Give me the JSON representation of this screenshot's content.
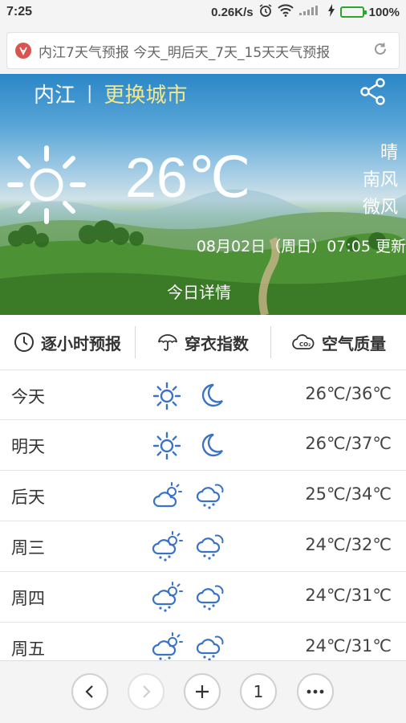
{
  "status_bar": {
    "time": "7:25",
    "network_speed": "0.26K/s",
    "battery": "100%",
    "icons": [
      "alarm-icon",
      "wifi-icon",
      "signal-icon",
      "charging-icon",
      "battery-icon"
    ]
  },
  "address_bar": {
    "text": "内江7天气预报 今天_明后天_7天_15天天气预报",
    "site_icon": "site-logo-icon",
    "reload_icon": "reload-icon"
  },
  "hero": {
    "city": "内江",
    "separator": "|",
    "change_city": "更换城市",
    "temperature": "26℃",
    "condition": "晴",
    "wind_direction": "南风",
    "wind_level": "微风",
    "update_time": "08月02日（周日）07:05 更新",
    "detail_link": "今日详情",
    "colors": {
      "change_city": "#f4e78a",
      "text": "#ffffff"
    }
  },
  "tabs": [
    {
      "label": "逐小时预报",
      "icon": "clock-icon"
    },
    {
      "label": "穿衣指数",
      "icon": "umbrella-icon"
    },
    {
      "label": "空气质量",
      "icon": "cloud-co2-icon"
    }
  ],
  "forecast": [
    {
      "day": "今天",
      "day_icon": "sun",
      "night_icon": "moon",
      "temp": "26℃/36℃"
    },
    {
      "day": "明天",
      "day_icon": "sun",
      "night_icon": "moon",
      "temp": "26℃/37℃"
    },
    {
      "day": "后天",
      "day_icon": "partly-cloudy",
      "night_icon": "rain-cloud",
      "temp": "25℃/34℃"
    },
    {
      "day": "周三",
      "day_icon": "sun-rain",
      "night_icon": "rain-cloud",
      "temp": "24℃/32℃"
    },
    {
      "day": "周四",
      "day_icon": "sun-rain",
      "night_icon": "rain-cloud",
      "temp": "24℃/31℃"
    },
    {
      "day": "周五",
      "day_icon": "sun-rain",
      "night_icon": "rain-cloud",
      "temp": "24℃/31℃"
    }
  ],
  "bottom_nav": {
    "back_icon": "back-arrow-icon",
    "forward_icon": "forward-arrow-icon",
    "new_tab_icon": "plus-icon",
    "tab_count": "1",
    "menu_icon": "more-icon"
  },
  "accent_color": "#3a73c6"
}
